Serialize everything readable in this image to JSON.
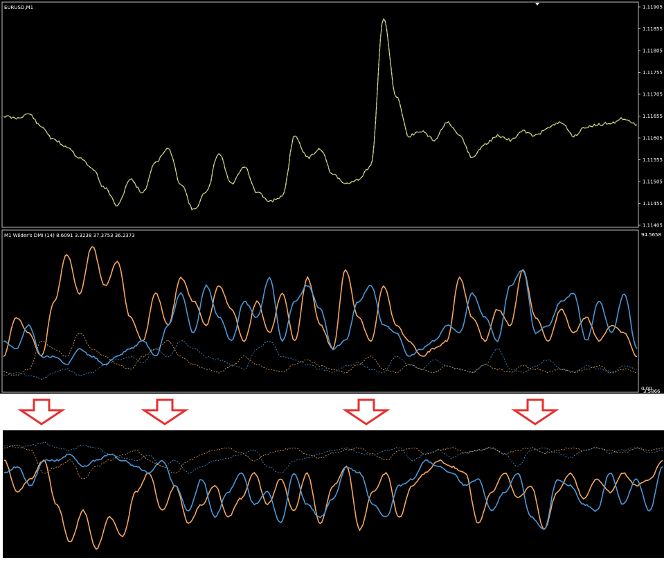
{
  "price_panel": {
    "symbol_label": "EURUSD,M1",
    "y_ticks": [
      "1.11905",
      "1.11855",
      "1.11805",
      "1.11755",
      "1.11705",
      "1.11655",
      "1.11605",
      "1.11555",
      "1.11505",
      "1.11455",
      "1.11405"
    ]
  },
  "indicator_panel": {
    "label": "M1 Wilder's DMI (14) 8.6091 3.3238 37.3753 36.2373",
    "y_top": "94.5658",
    "y_bottom": "0.00",
    "y_bottom_overlap": "3.5866"
  },
  "colors": {
    "background": "#000000",
    "grid_border": "#c0c0c0",
    "price_up": "#f2e35a",
    "price_down": "#4aa3e0",
    "orange": "#f4a55c",
    "blue": "#4a97d8",
    "arrow_red": "#e53030"
  },
  "arrows": [
    "down-arrow",
    "down-arrow",
    "down-arrow",
    "down-arrow"
  ],
  "chart_data": [
    {
      "type": "line",
      "title": "EURUSD,M1",
      "ylim": [
        1.11405,
        1.11905
      ],
      "x": [
        0,
        2,
        4,
        6,
        8,
        10,
        12,
        14,
        16,
        18,
        20,
        22,
        24,
        26,
        28,
        30,
        32,
        34,
        36,
        38,
        40,
        42,
        44,
        46,
        48,
        50,
        52,
        54,
        56,
        58,
        60,
        62,
        64,
        66,
        68,
        70,
        72,
        74,
        76,
        78,
        80,
        82,
        84,
        86,
        88,
        90,
        92,
        94,
        96,
        98,
        100
      ],
      "series": [
        {
          "values": [
            1.11655,
            1.1165,
            1.1166,
            1.1163,
            1.116,
            1.11585,
            1.1156,
            1.11535,
            1.1149,
            1.1145,
            1.1151,
            1.1148,
            1.1155,
            1.1158,
            1.115,
            1.1144,
            1.1148,
            1.1157,
            1.115,
            1.1154,
            1.1148,
            1.1146,
            1.1147,
            1.1161,
            1.1156,
            1.1158,
            1.1152,
            1.115,
            1.1151,
            1.1154,
            1.1188,
            1.117,
            1.1161,
            1.1162,
            1.116,
            1.1164,
            1.1161,
            1.1156,
            1.1159,
            1.1161,
            1.116,
            1.1162,
            1.1161,
            1.1163,
            1.1164,
            1.1161,
            1.1163,
            1.11635,
            1.1164,
            1.1165,
            1.11635
          ]
        }
      ]
    },
    {
      "type": "line",
      "title": "M1 Wilder's DMI (14) 8.6091 3.3238 37.3753 36.2373",
      "ylim": [
        0,
        94.5658
      ],
      "x": [
        0,
        2,
        4,
        6,
        8,
        10,
        12,
        14,
        16,
        18,
        20,
        22,
        24,
        26,
        28,
        30,
        32,
        34,
        36,
        38,
        40,
        42,
        44,
        46,
        48,
        50,
        52,
        54,
        56,
        58,
        60,
        62,
        64,
        66,
        68,
        70,
        72,
        74,
        76,
        78,
        80,
        82,
        84,
        86,
        88,
        90,
        92,
        94,
        96,
        98,
        100
      ],
      "series": [
        {
          "values": [
            20,
            45,
            35,
            20,
            55,
            85,
            60,
            90,
            65,
            80,
            45,
            30,
            60,
            40,
            70,
            55,
            40,
            65,
            50,
            30,
            55,
            35,
            60,
            30,
            70,
            40,
            25,
            75,
            45,
            30,
            65,
            40,
            30,
            20,
            25,
            30,
            70,
            45,
            30,
            50,
            40,
            75,
            45,
            30,
            50,
            35,
            45,
            30,
            40,
            35,
            20
          ]
        },
        {
          "values": [
            30,
            25,
            40,
            20,
            20,
            15,
            25,
            20,
            15,
            20,
            25,
            30,
            20,
            40,
            60,
            35,
            65,
            45,
            30,
            55,
            45,
            70,
            30,
            55,
            65,
            50,
            25,
            30,
            55,
            65,
            40,
            35,
            20,
            25,
            30,
            40,
            35,
            60,
            45,
            30,
            65,
            75,
            35,
            40,
            55,
            60,
            30,
            55,
            35,
            60,
            25
          ]
        },
        {
          "values": [
            10,
            8,
            12,
            30,
            25,
            20,
            35,
            25,
            20,
            15,
            12,
            20,
            25,
            30,
            20,
            15,
            12,
            10,
            14,
            20,
            15,
            12,
            10,
            15,
            18,
            14,
            12,
            10,
            15,
            20,
            12,
            10,
            15,
            12,
            10,
            14,
            12,
            10,
            15,
            12,
            10,
            14,
            12,
            10,
            12,
            10,
            12,
            14,
            10,
            12,
            10
          ]
        },
        {
          "values": [
            8,
            10,
            8,
            6,
            10,
            12,
            8,
            10,
            15,
            18,
            20,
            16,
            25,
            20,
            30,
            25,
            20,
            18,
            15,
            12,
            25,
            30,
            20,
            18,
            15,
            12,
            10,
            14,
            16,
            12,
            10,
            20,
            15,
            12,
            18,
            14,
            12,
            10,
            15,
            25,
            12,
            10,
            14,
            18,
            12,
            10,
            14,
            12,
            10,
            14,
            12
          ]
        }
      ]
    }
  ]
}
